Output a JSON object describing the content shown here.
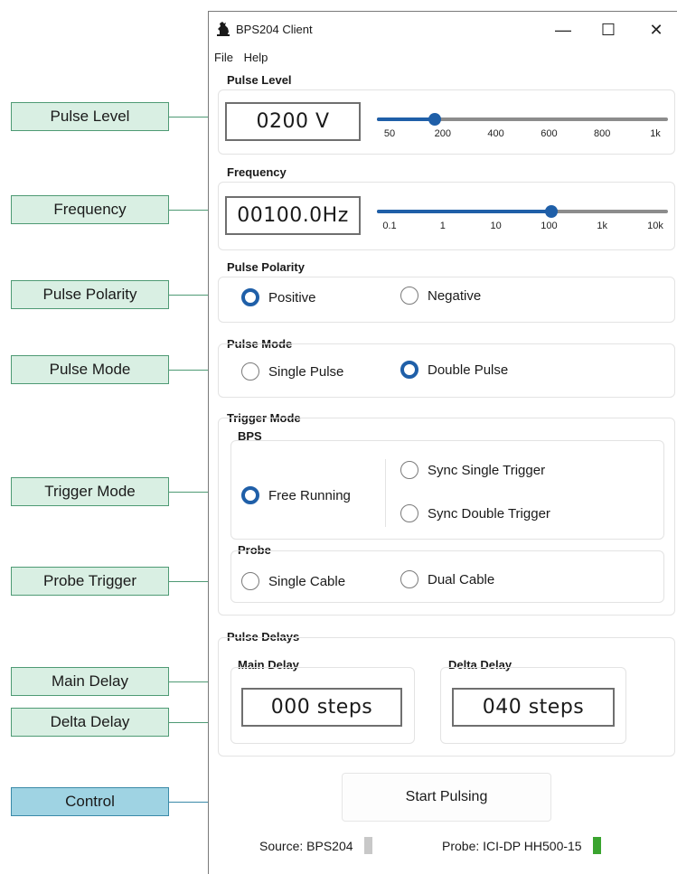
{
  "callouts": {
    "pulse_level": "Pulse Level",
    "frequency": "Frequency",
    "pulse_polarity": "Pulse Polarity",
    "pulse_mode": "Pulse Mode",
    "trigger_mode": "Trigger Mode",
    "probe_trigger": "Probe Trigger",
    "main_delay": "Main Delay",
    "delta_delay": "Delta Delay",
    "control": "Control"
  },
  "window": {
    "title": "BPS204 Client",
    "minimize": "—",
    "maximize": "☐",
    "close": "✕"
  },
  "menu": {
    "file": "File",
    "help": "Help"
  },
  "pulse_level": {
    "title": "Pulse Level",
    "value": "0200 V",
    "ticks": [
      "50",
      "200",
      "400",
      "600",
      "800",
      "1k"
    ],
    "slider_fraction": 0.2
  },
  "frequency": {
    "title": "Frequency",
    "value": "00100.0Hz",
    "ticks": [
      "0.1",
      "1",
      "10",
      "100",
      "1k",
      "10k"
    ],
    "slider_fraction": 0.6
  },
  "pulse_polarity": {
    "title": "Pulse Polarity",
    "positive": "Positive",
    "negative": "Negative",
    "selected": "positive"
  },
  "pulse_mode": {
    "title": "Pulse Mode",
    "single": "Single Pulse",
    "double": "Double Pulse",
    "selected": "double"
  },
  "trigger_mode": {
    "title": "Trigger Mode",
    "bps_title": "BPS",
    "free_running": "Free Running",
    "sync_single": "Sync Single Trigger",
    "sync_double": "Sync Double Trigger",
    "selected": "free_running",
    "probe_title": "Probe",
    "single_cable": "Single Cable",
    "dual_cable": "Dual Cable"
  },
  "pulse_delays": {
    "title": "Pulse Delays",
    "main_title": "Main Delay",
    "main_value": "000 steps",
    "delta_title": "Delta Delay",
    "delta_value": "040 steps"
  },
  "control": {
    "start_label": "Start Pulsing"
  },
  "status": {
    "source": "Source: BPS204",
    "source_color": "#c8c8c8",
    "probe": "Probe: ICI-DP HH500-15",
    "probe_color": "#3aa42f"
  },
  "colors": {
    "accent": "#1f5fa8",
    "callout_fill": "#d9efe3",
    "control_fill": "#9fd3e3"
  }
}
